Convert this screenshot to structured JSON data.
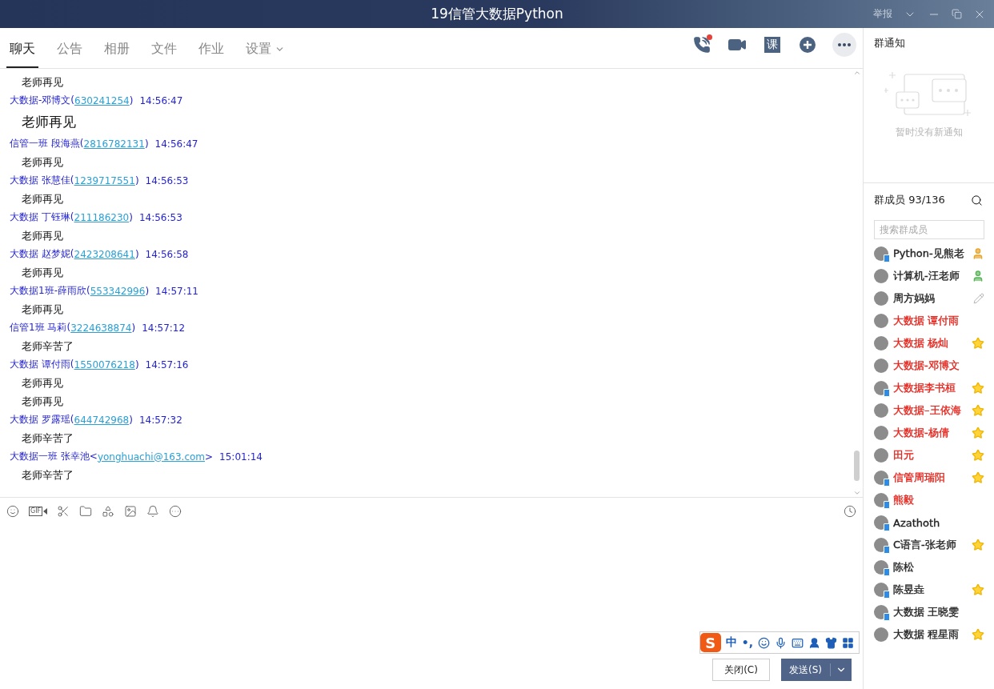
{
  "window": {
    "title": "19信管大数据Python",
    "report": "举报"
  },
  "tabs": [
    {
      "label": "聊天",
      "selected": true,
      "dropdown": false
    },
    {
      "label": "公告",
      "selected": false,
      "dropdown": false
    },
    {
      "label": "相册",
      "selected": false,
      "dropdown": false
    },
    {
      "label": "文件",
      "selected": false,
      "dropdown": false
    },
    {
      "label": "作业",
      "selected": false,
      "dropdown": false
    },
    {
      "label": "设置",
      "selected": false,
      "dropdown": true
    }
  ],
  "header_actions": [
    {
      "kind": "call",
      "unread": true
    },
    {
      "kind": "video",
      "unread": false
    },
    {
      "kind": "course",
      "label": "课",
      "unread": false
    },
    {
      "kind": "add",
      "unread": false
    },
    {
      "kind": "more",
      "unread": false
    }
  ],
  "chat": [
    {
      "kind": "message",
      "text": "老师再见",
      "large": false
    },
    {
      "kind": "sender",
      "name": "大数据-邓博文",
      "open": "(",
      "id": "630241254",
      "close": ")",
      "time": "14:56:47"
    },
    {
      "kind": "message",
      "text": "老师再见",
      "large": true
    },
    {
      "kind": "sender",
      "name": "信管一班 段海燕",
      "open": "(",
      "id": "2816782131",
      "close": ")",
      "time": "14:56:47"
    },
    {
      "kind": "message",
      "text": "老师再见",
      "large": false
    },
    {
      "kind": "sender",
      "name": "大数据 张慧佳",
      "open": "(",
      "id": "1239717551",
      "close": ")",
      "time": "14:56:53"
    },
    {
      "kind": "message",
      "text": "老师再见",
      "large": false
    },
    {
      "kind": "sender",
      "name": "大数据 丁钰琳",
      "open": "(",
      "id": "211186230",
      "close": ")",
      "time": "14:56:53"
    },
    {
      "kind": "message",
      "text": "老师再见",
      "large": false
    },
    {
      "kind": "sender",
      "name": "大数据 赵梦妮",
      "open": "(",
      "id": "2423208641",
      "close": ")",
      "time": "14:56:58"
    },
    {
      "kind": "message",
      "text": "老师再见",
      "large": false
    },
    {
      "kind": "sender",
      "name": "大数据1班-薛雨欣",
      "open": "(",
      "id": "553342996",
      "close": ")",
      "time": "14:57:11"
    },
    {
      "kind": "message",
      "text": "老师再见",
      "large": false
    },
    {
      "kind": "sender",
      "name": "信管1班 马莉",
      "open": "(",
      "id": "3224638874",
      "close": ")",
      "time": "14:57:12"
    },
    {
      "kind": "message",
      "text": "老师辛苦了",
      "large": false
    },
    {
      "kind": "sender",
      "name": "大数据 谭付雨",
      "open": "(",
      "id": "1550076218",
      "close": ")",
      "time": "14:57:16"
    },
    {
      "kind": "message",
      "text": "老师再见",
      "large": false
    },
    {
      "kind": "message",
      "text": "老师再见",
      "large": false
    },
    {
      "kind": "sender",
      "name": "大数据 罗露瑶",
      "open": "(",
      "id": "644742968",
      "close": ")",
      "time": "14:57:32"
    },
    {
      "kind": "message",
      "text": "老师辛苦了",
      "large": false
    },
    {
      "kind": "sender",
      "name": "大数据一班  张幸池",
      "open": "<",
      "id": "yonghuachi@163.com",
      "close": ">",
      "time": "15:01:14"
    },
    {
      "kind": "message",
      "text": "老师辛苦了",
      "large": false
    }
  ],
  "composer": {
    "tools": [
      {
        "kind": "emoji"
      },
      {
        "kind": "gif",
        "label": "GIF"
      },
      {
        "kind": "scissors"
      },
      {
        "kind": "folder"
      },
      {
        "kind": "shapes"
      },
      {
        "kind": "image"
      },
      {
        "kind": "bell"
      },
      {
        "kind": "more"
      }
    ],
    "ime": {
      "logo": "S",
      "mode": "中",
      "punct": "•,"
    },
    "close_button": "关闭(C)",
    "send_button": "发送(S)"
  },
  "notice": {
    "title": "群通知",
    "empty": "暂时没有新通知"
  },
  "members": {
    "title": "群成员 93/136",
    "search_placeholder": "搜索群成员",
    "items": [
      {
        "name": "Python-见熊老",
        "color": "#222222",
        "kind": "owner",
        "mobile": true
      },
      {
        "name": "计算机-汪老师",
        "color": "#222222",
        "kind": "admin",
        "mobile": false
      },
      {
        "name": "周方妈妈",
        "color": "#222222",
        "kind": "editor",
        "mobile": false
      },
      {
        "name": "大数据 谭付雨",
        "color": "#e5231b",
        "kind": "plain",
        "mobile": false
      },
      {
        "name": "大数据 杨灿",
        "color": "#e5231b",
        "kind": "star",
        "mobile": false
      },
      {
        "name": "大数据-邓博文",
        "color": "#e5231b",
        "kind": "plain",
        "mobile": false
      },
      {
        "name": "大数据李书桓",
        "color": "#e5231b",
        "kind": "star",
        "mobile": true
      },
      {
        "name": "大数据–王依海",
        "color": "#e5231b",
        "kind": "star",
        "mobile": false
      },
      {
        "name": "大数据-杨倩",
        "color": "#e5231b",
        "kind": "star",
        "mobile": false
      },
      {
        "name": "田元",
        "color": "#e5231b",
        "kind": "star",
        "mobile": false
      },
      {
        "name": "信管周瑞阳",
        "color": "#e5231b",
        "kind": "star",
        "mobile": true
      },
      {
        "name": "熊毅",
        "color": "#e5231b",
        "kind": "plain",
        "mobile": true
      },
      {
        "name": "Azathoth",
        "color": "#222222",
        "kind": "plain",
        "mobile": true
      },
      {
        "name": "C语言-张老师",
        "color": "#222222",
        "kind": "star",
        "mobile": true
      },
      {
        "name": "陈松",
        "color": "#222222",
        "kind": "plain",
        "mobile": true
      },
      {
        "name": "陈昱垚",
        "color": "#222222",
        "kind": "star",
        "mobile": true
      },
      {
        "name": "大数据  王晓雯",
        "color": "#222222",
        "kind": "plain",
        "mobile": true
      },
      {
        "name": "大数据 程星雨",
        "color": "#222222",
        "kind": "star",
        "mobile": false
      }
    ]
  }
}
